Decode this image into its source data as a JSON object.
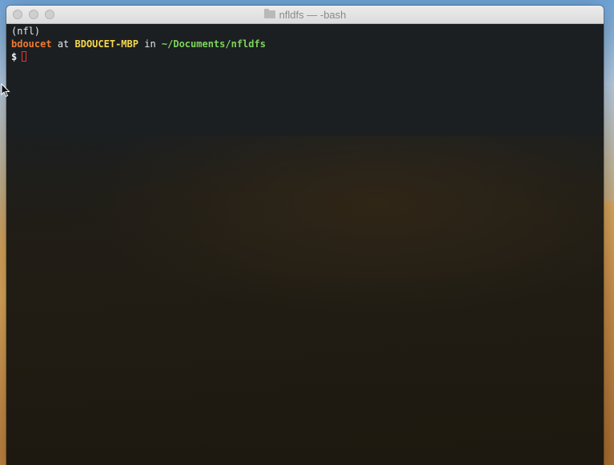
{
  "window": {
    "title": "nfldfs — -bash",
    "folder_icon": "folder-icon"
  },
  "terminal": {
    "env_line": "(nfl)",
    "prompt": {
      "user": "bdoucet",
      "at": "at",
      "host": "BDOUCET-MBP",
      "in": "in",
      "path": "~/Documents/nfldfs"
    },
    "input_prefix": "$",
    "input_value": ""
  },
  "colors": {
    "user": "#f07a30",
    "host": "#f7d84a",
    "path": "#7fd35a",
    "cursor": "#e8322e"
  },
  "cursor_icon": "mouse-pointer-icon"
}
